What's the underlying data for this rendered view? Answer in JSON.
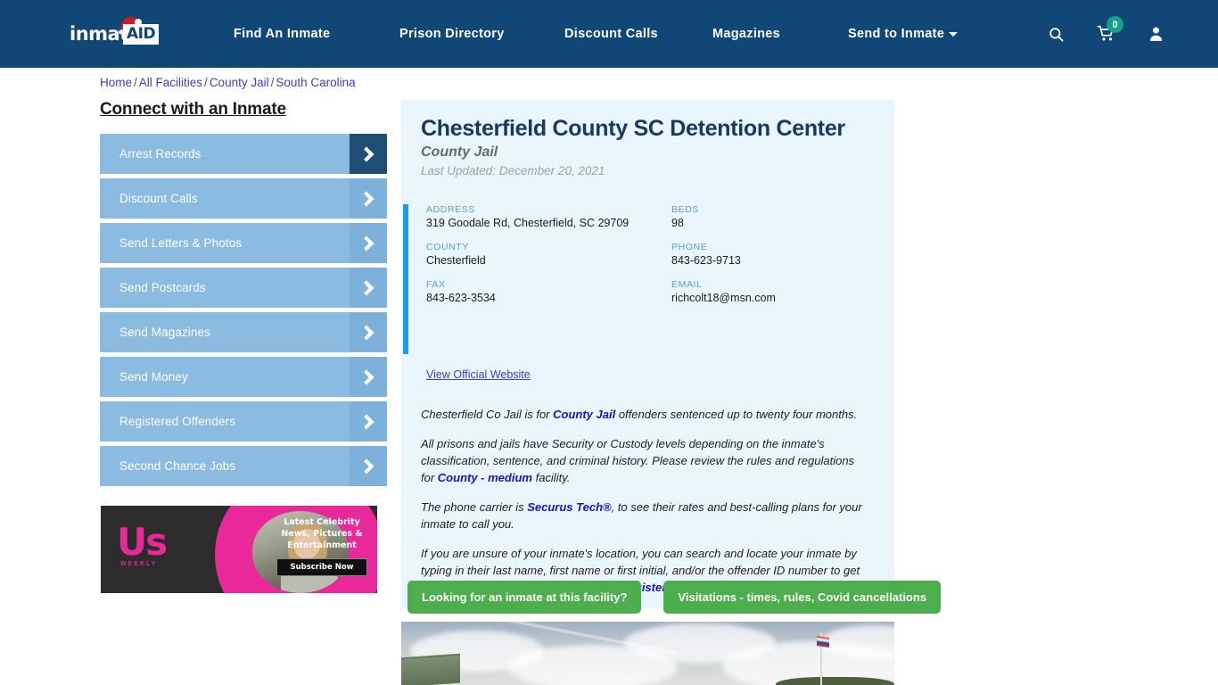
{
  "header": {
    "logo_text": "inmate",
    "logo_badge": "AID",
    "nav_items": [
      {
        "label": "Find An Inmate",
        "has_caret": false
      },
      {
        "label": "Prison Directory",
        "has_caret": false
      },
      {
        "label": "Discount Calls",
        "has_caret": false
      },
      {
        "label": "Magazines",
        "has_caret": false
      },
      {
        "label": "Send to Inmate",
        "has_caret": true
      }
    ],
    "search_icon": "search-icon",
    "cart_icon": "cart-icon",
    "cart_count": "0",
    "account_icon": "user-icon",
    "background_color": "#104777"
  },
  "breadcrumb": {
    "items": [
      "Home",
      "All Facilities",
      "County Jail",
      "South Carolina"
    ],
    "separator": "/"
  },
  "sidebar": {
    "title": "Connect with an Inmate",
    "items": [
      {
        "label": "Arrest Records"
      },
      {
        "label": "Discount Calls"
      },
      {
        "label": "Send Letters & Photos"
      },
      {
        "label": "Send Postcards"
      },
      {
        "label": "Send Magazines"
      },
      {
        "label": "Send Money"
      },
      {
        "label": "Registered Offenders"
      },
      {
        "label": "Second Chance Jobs"
      }
    ],
    "active_index": 0
  },
  "ad": {
    "brand": "Us",
    "brand_sub": "WEEKLY",
    "tagline": "Latest Celebrity News, Pictures & Entertainment",
    "cta": "Subscribe Now"
  },
  "facility": {
    "name": "Chesterfield County SC Detention Center",
    "type": "County Jail",
    "last_updated": "Last Updated: December 20, 2021",
    "fields": [
      {
        "label": "ADDRESS",
        "value": "319 Goodale Rd, Chesterfield, SC 29709"
      },
      {
        "label": "BEDS",
        "value": "98"
      },
      {
        "label": "COUNTY",
        "value": "Chesterfield"
      },
      {
        "label": "PHONE",
        "value": "843-623-9713"
      },
      {
        "label": "FAX",
        "value": "843-623-3534"
      },
      {
        "label": "EMAIL",
        "value": "richcolt18@msn.com"
      }
    ],
    "official_website_link": "View Official Website",
    "accent_color": "#1f9bf0"
  },
  "description": {
    "p1_a": "Chesterfield Co Jail is for ",
    "p1_link": "County Jail",
    "p1_b": " offenders sentenced up to twenty four months.",
    "p2_a": "All prisons and jails have Security or Custody levels depending on the inmate's classification, sentence, and criminal history. Please review the rules and regulations for ",
    "p2_link": "County - medium",
    "p2_b": " facility.",
    "p3_a": "The phone carrier is ",
    "p3_link": "Securus Tech®",
    "p3_b": ", to see their rates and best-calling plans for your inmate to call you.",
    "p4_a": "If you are unsure of your inmate's location, you can search and locate your inmate by typing in their last name, first name or first initial, and/or the offender ID number to get their accurate information immediately ",
    "p4_link": "Registered Offenders",
    "p4_b": ""
  },
  "actions": {
    "inmate_search_button": "Looking for an inmate at this facility?",
    "visitation_button": "Visitations - times, rules, Covid cancellations",
    "button_color": "#4cae4c"
  },
  "facility_photo": {
    "alt": "facility-exterior-photo-sky-flagpole"
  }
}
